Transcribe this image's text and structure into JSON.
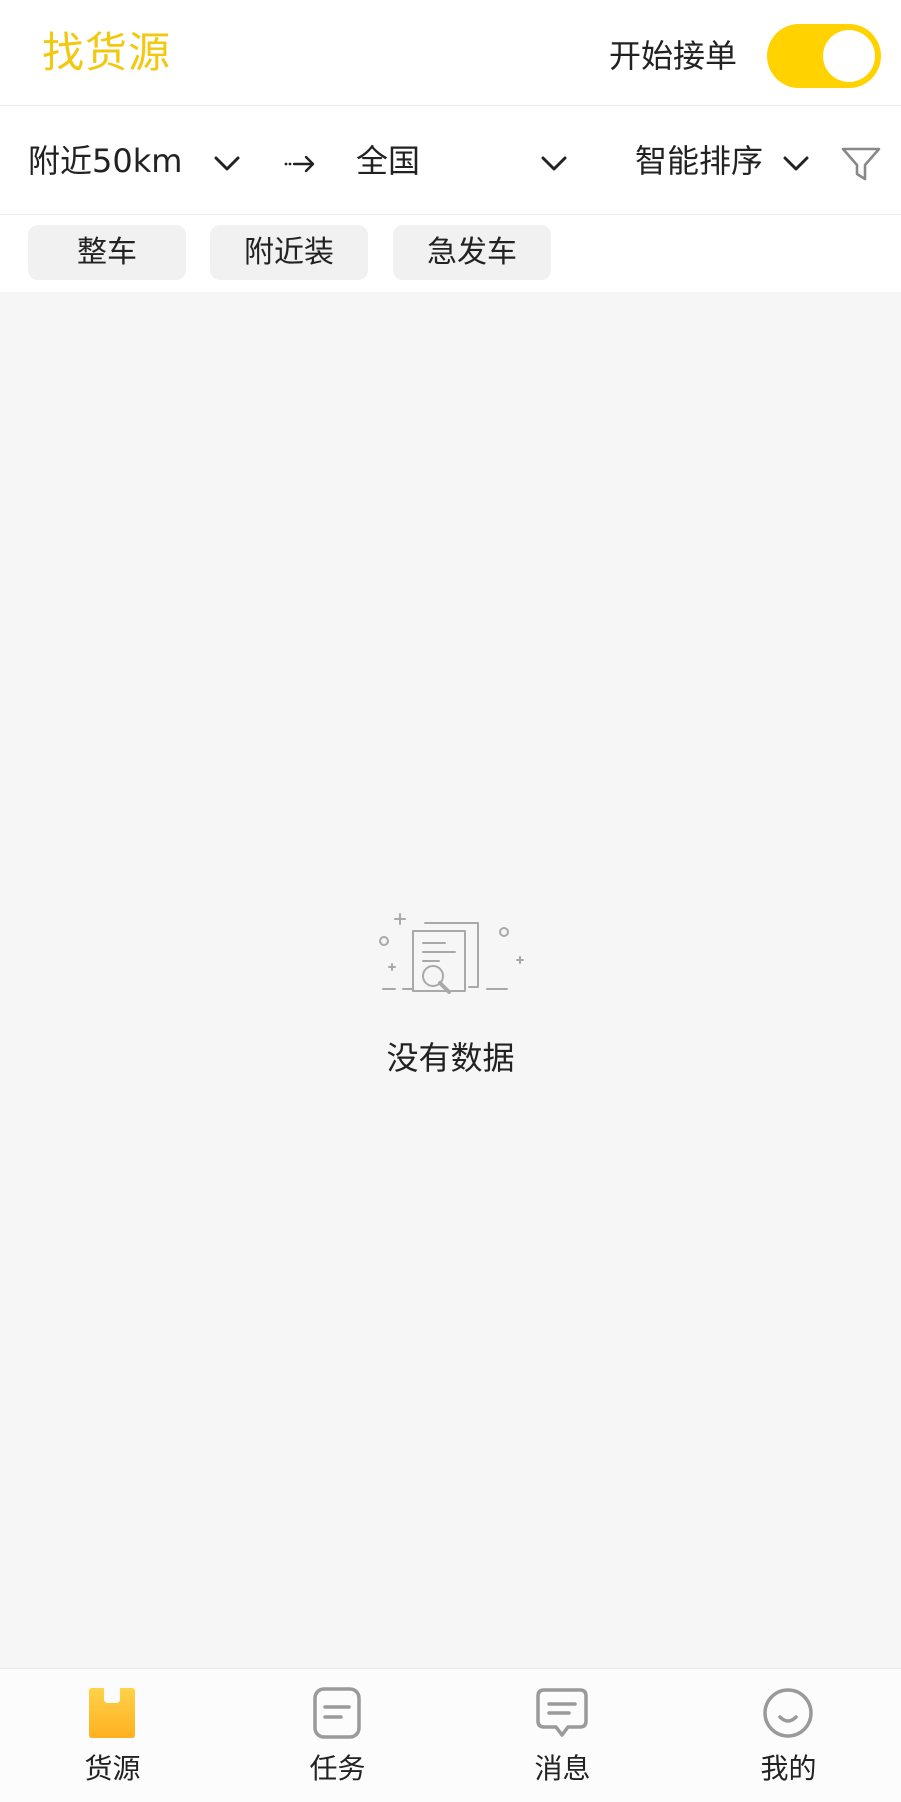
{
  "header": {
    "title": "找货源",
    "accept_orders_label": "开始接单",
    "accept_orders_on": true
  },
  "filters": {
    "origin": "附近50km",
    "destination": "全国",
    "sort": "智能排序"
  },
  "chips": [
    "整车",
    "附近装",
    "急发车"
  ],
  "empty_state": {
    "text": "没有数据"
  },
  "bottom_nav": {
    "items": [
      {
        "label": "货源",
        "icon": "box-icon",
        "active": true
      },
      {
        "label": "任务",
        "icon": "task-list-icon",
        "active": false
      },
      {
        "label": "消息",
        "icon": "message-icon",
        "active": false
      },
      {
        "label": "我的",
        "icon": "smiley-icon",
        "active": false
      }
    ]
  },
  "colors": {
    "accent": "#ffd200",
    "title": "#f2c811",
    "content_bg": "#f6f6f6",
    "icon_gray": "#9a9a9a"
  }
}
